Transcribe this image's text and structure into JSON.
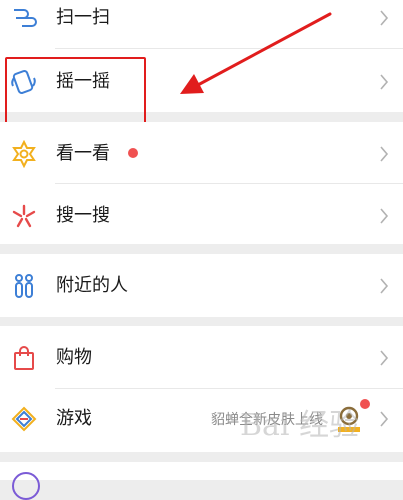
{
  "menu": {
    "scan": "扫一扫",
    "shake": "摇一摇",
    "top_stories": "看一看",
    "search": "搜一搜",
    "people_nearby": "附近的人",
    "shopping": "购物",
    "games": "游戏",
    "games_promo": "貂蝉全新皮肤上线"
  },
  "watermark": "Bai 经验",
  "colors": {
    "accent_red": "#e11d1d",
    "dot_red": "#f05151",
    "chevron": "#b2b2b2",
    "background": "#ededed"
  },
  "icons": {
    "scan": "scan-icon",
    "shake": "shake-icon",
    "top_stories": "top-stories-icon",
    "search": "search-icon",
    "people_nearby": "people-nearby-icon",
    "shopping": "shopping-bag-icon",
    "games": "games-icon"
  }
}
